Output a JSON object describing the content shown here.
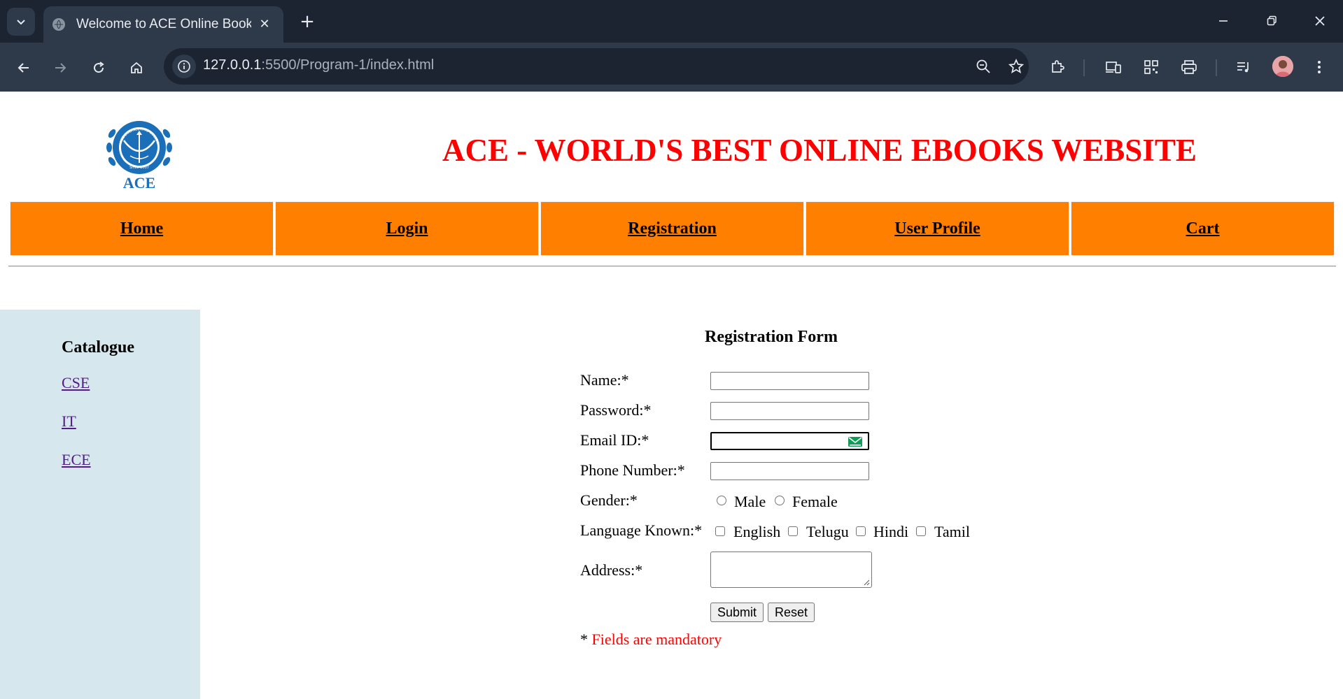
{
  "browser": {
    "tab_title": "Welcome to ACE Online Book's",
    "url_host": "127.0.0.1",
    "url_rest": ":5500/Program-1/index.html"
  },
  "site": {
    "logo": {
      "arc_text": "ACE ENGINEERING COLLEGE",
      "since": "Since 2007",
      "name": "ACE"
    },
    "title": "ACE - WORLD'S BEST ONLINE EBOOKS WEBSITE",
    "nav": [
      "Home",
      "Login",
      "Registration",
      "User Profile",
      "Cart"
    ]
  },
  "sidebar": {
    "title": "Catalogue",
    "links": [
      "CSE",
      "IT",
      "ECE"
    ]
  },
  "form": {
    "title": "Registration Form",
    "labels": {
      "name": "Name:*",
      "password": "Password:*",
      "email": "Email ID:*",
      "phone": "Phone Number:*",
      "gender": "Gender:*",
      "language": "Language Known:*",
      "address": "Address:*"
    },
    "values": {
      "name": "",
      "password": "",
      "email": "",
      "phone": "",
      "address": ""
    },
    "gender_options": [
      "Male",
      "Female"
    ],
    "language_options": [
      "English",
      "Telugu",
      "Hindi",
      "Tamil"
    ],
    "submit_label": "Submit",
    "reset_label": "Reset",
    "mandatory_star": "*",
    "mandatory_text": "Fields are mandatory"
  },
  "colors": {
    "title_red": "#ff0000",
    "nav_orange": "#ff7f00",
    "sidebar_bg": "#d6e7ee",
    "link_visited": "#551a8b",
    "logo_blue": "#1a6fb8"
  }
}
